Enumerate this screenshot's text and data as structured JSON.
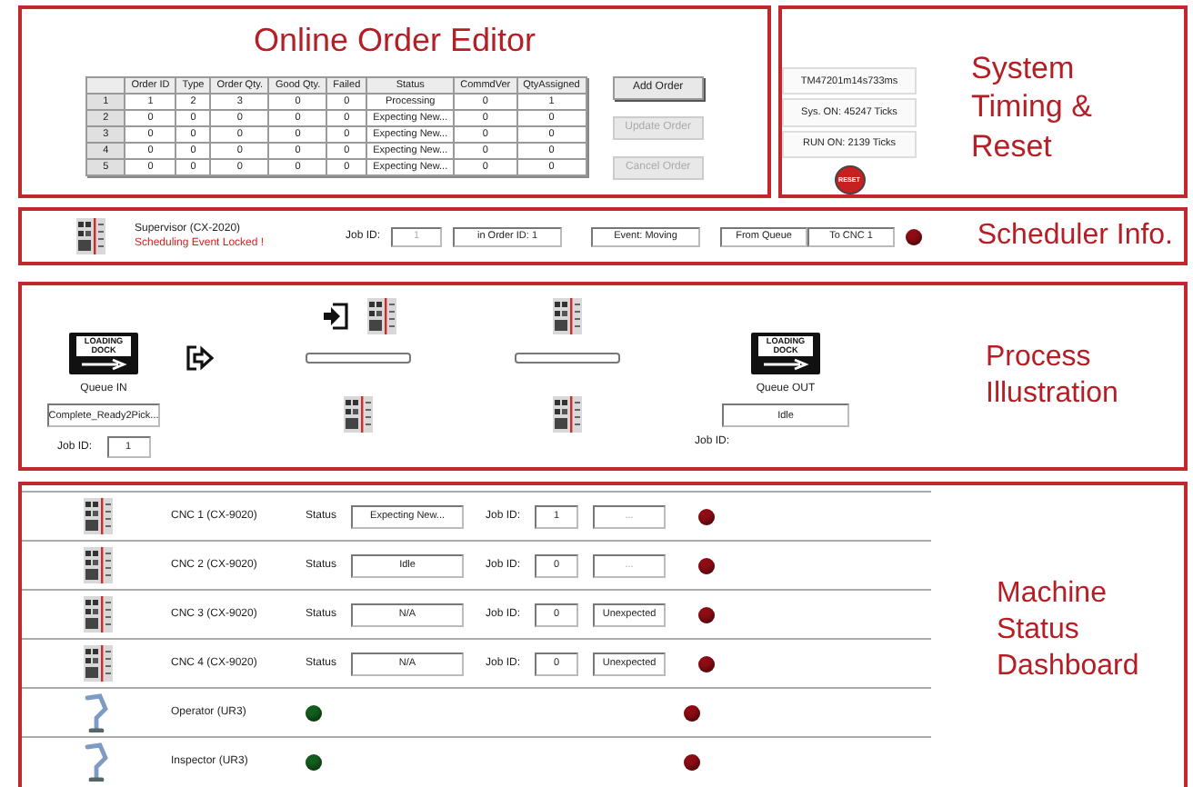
{
  "order_editor": {
    "title": "Online Order Editor",
    "table": {
      "columns": [
        "Order ID",
        "Type",
        "Order Qty.",
        "Good Qty.",
        "Failed",
        "Status",
        "CommdVer",
        "QtyAssigned"
      ],
      "rows": [
        {
          "index": "1",
          "cells": [
            "1",
            "2",
            "3",
            "0",
            "0",
            "Processing",
            "0",
            "1"
          ]
        },
        {
          "index": "2",
          "cells": [
            "0",
            "0",
            "0",
            "0",
            "0",
            "Expecting New...",
            "0",
            "0"
          ]
        },
        {
          "index": "3",
          "cells": [
            "0",
            "0",
            "0",
            "0",
            "0",
            "Expecting New...",
            "0",
            "0"
          ]
        },
        {
          "index": "4",
          "cells": [
            "0",
            "0",
            "0",
            "0",
            "0",
            "Expecting New...",
            "0",
            "0"
          ]
        },
        {
          "index": "5",
          "cells": [
            "0",
            "0",
            "0",
            "0",
            "0",
            "Expecting New...",
            "0",
            "0"
          ]
        }
      ]
    },
    "buttons": [
      {
        "label": "Add Order",
        "disabled": false
      },
      {
        "label": "Update Order",
        "disabled": true
      },
      {
        "label": "Cancel Order",
        "disabled": true
      }
    ]
  },
  "system_timing": {
    "title": "System Timing & Reset",
    "readouts": [
      "TM47201m14s733ms",
      "Sys. ON: 45247 Ticks",
      "RUN ON: 2139 Ticks"
    ],
    "reset_button": "RESET"
  },
  "scheduler": {
    "title": "Scheduler Info.",
    "name": "Supervisor (CX-2020)",
    "message": "Scheduling Event Locked !",
    "job_id_label": "Job ID:",
    "job_id": "1",
    "fields": [
      "in Order ID: 1",
      "Event: Moving",
      "From Queue",
      "To CNC 1"
    ],
    "indicator": {
      "color": "#8e0c14"
    }
  },
  "process": {
    "title": "Process Illustration",
    "queue_in": {
      "sign": "LOADING DOCK",
      "label": "Queue IN",
      "value": "Complete_Ready2Pick...",
      "job_id_label": "Job ID:",
      "job_id": "1"
    },
    "transfers": [
      {
        "level": 0
      },
      {
        "level": 0
      }
    ],
    "queue_out": {
      "sign": "LOADING DOCK",
      "label": "Queue OUT",
      "value": "Idle",
      "job_id_label": "Job ID:"
    }
  },
  "machines": {
    "title": "Machine Status Dashboard",
    "rows": [
      {
        "kind": "cnc",
        "name": "CNC 1 (CX-9020)",
        "status_label": "Status",
        "status": "Expecting New...",
        "job_id_label": "Job ID:",
        "job_id": "1",
        "extra": "...",
        "extra_disabled": true,
        "indicator": {
          "color": "#8e0c14"
        }
      },
      {
        "kind": "cnc",
        "name": "CNC 2 (CX-9020)",
        "status_label": "Status",
        "status": "Idle",
        "job_id_label": "Job ID:",
        "job_id": "0",
        "extra": "...",
        "extra_disabled": true,
        "indicator": {
          "color": "#8e0c14"
        }
      },
      {
        "kind": "cnc",
        "name": "CNC 3 (CX-9020)",
        "status_label": "Status",
        "status": "N/A",
        "job_id_label": "Job ID:",
        "job_id": "0",
        "extra": "Unexpected",
        "extra_disabled": false,
        "indicator": {
          "color": "#8e0c14"
        }
      },
      {
        "kind": "cnc",
        "name": "CNC 4 (CX-9020)",
        "status_label": "Status",
        "status": "N/A",
        "job_id_label": "Job ID:",
        "job_id": "0",
        "extra": "Unexpected",
        "extra_disabled": false,
        "indicator": {
          "color": "#8e0c14"
        }
      },
      {
        "kind": "robot",
        "name": "Operator (UR3)",
        "ready_indicator": {
          "color": "#135e1c"
        },
        "indicator": {
          "color": "#8e0c14"
        }
      },
      {
        "kind": "robot",
        "name": "Inspector (UR3)",
        "ready_indicator": {
          "color": "#135e1c"
        },
        "indicator": {
          "color": "#8e0c14"
        }
      }
    ]
  }
}
